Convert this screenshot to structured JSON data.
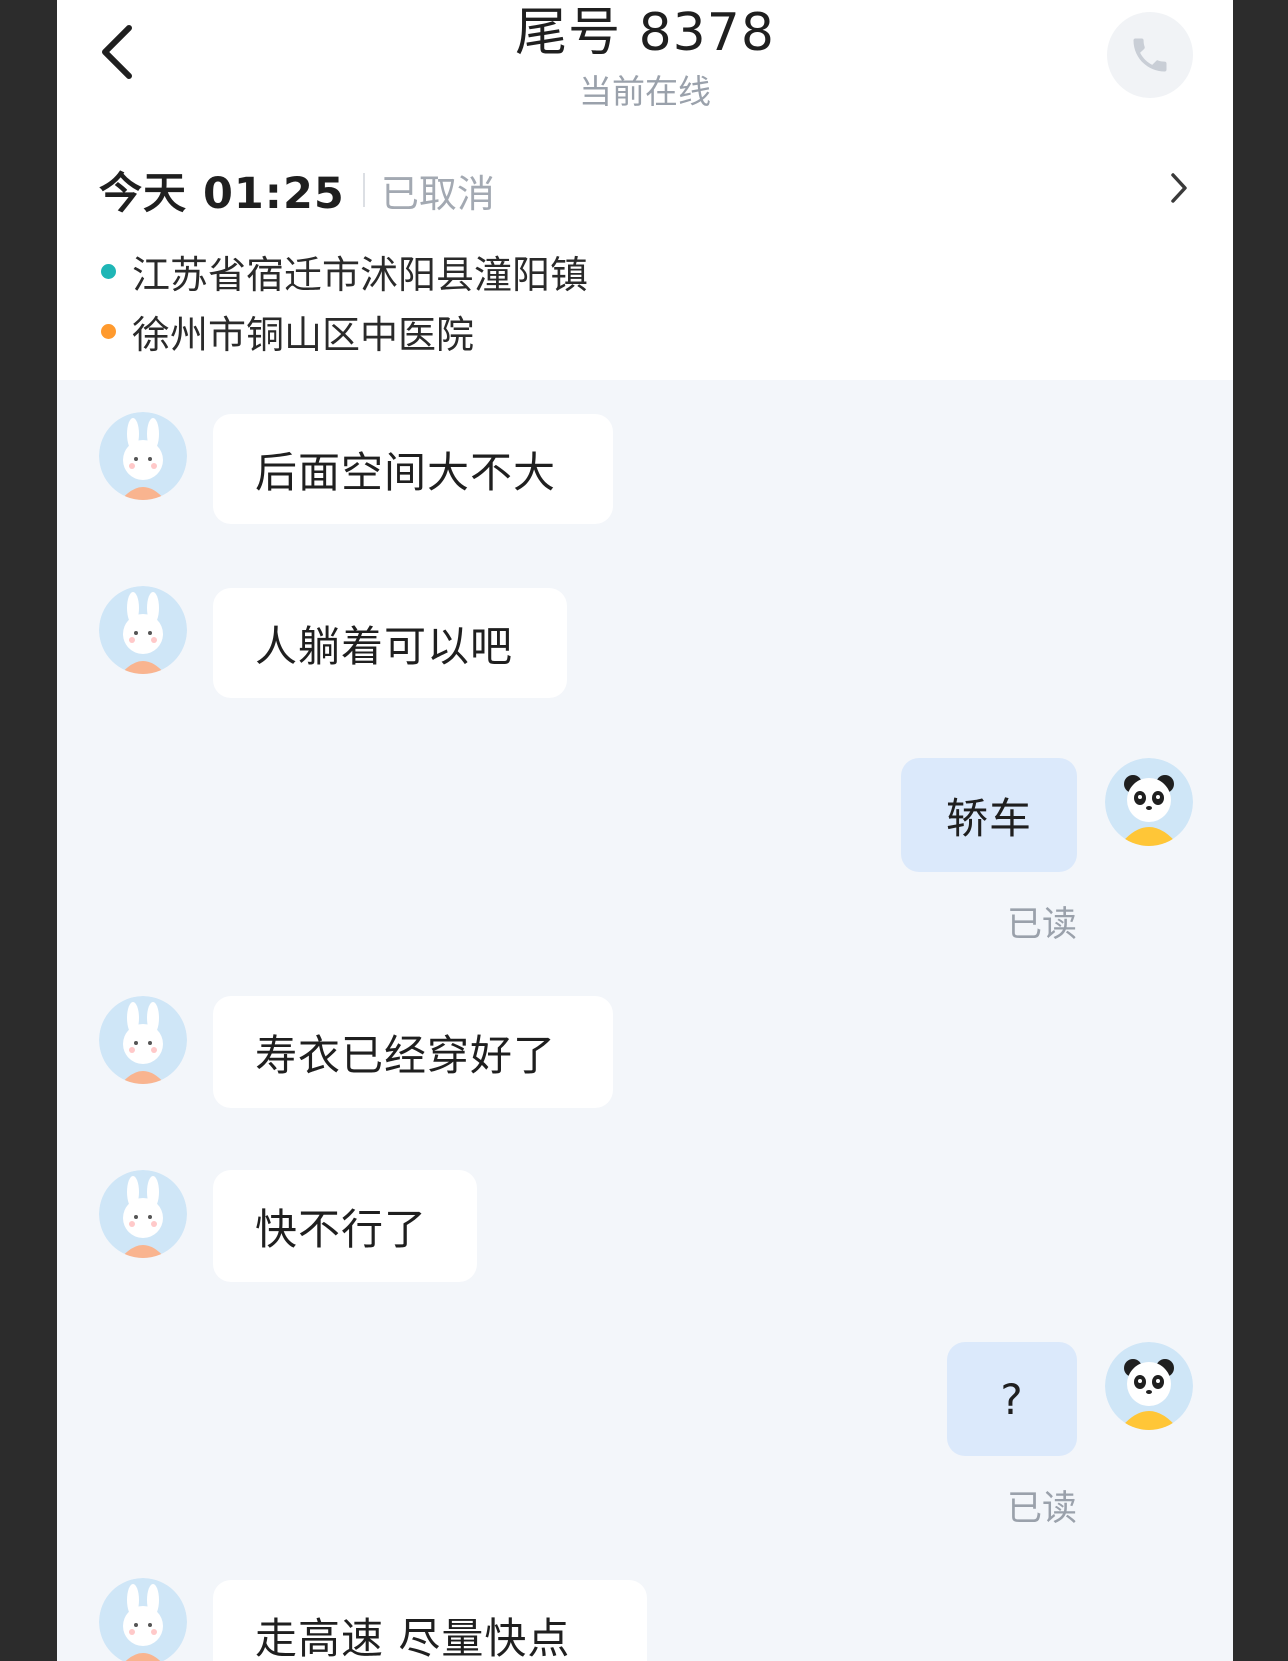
{
  "header": {
    "title": "尾号 8378",
    "subtitle": "当前在线"
  },
  "order": {
    "time": "今天 01:25",
    "status": "已取消",
    "origin": "江苏省宿迁市沭阳县潼阳镇",
    "destination": "徐州市铜山区中医院"
  },
  "messages": [
    {
      "from": "passenger",
      "text": "后面空间大不大"
    },
    {
      "from": "passenger",
      "text": "人躺着可以吧"
    },
    {
      "from": "driver",
      "text": "轿车",
      "receipt": "已读"
    },
    {
      "from": "passenger",
      "text": "寿衣已经穿好了"
    },
    {
      "from": "passenger",
      "text": "快不行了"
    },
    {
      "from": "driver",
      "text": "?",
      "receipt": "已读"
    },
    {
      "from": "passenger",
      "text": "走高速  尽量快点"
    }
  ],
  "colors": {
    "origin_dot": "#1fb6b6",
    "destination_dot": "#ff9a2e",
    "outgoing_bubble": "#dbe9fb",
    "chat_background": "#f3f6fa"
  }
}
